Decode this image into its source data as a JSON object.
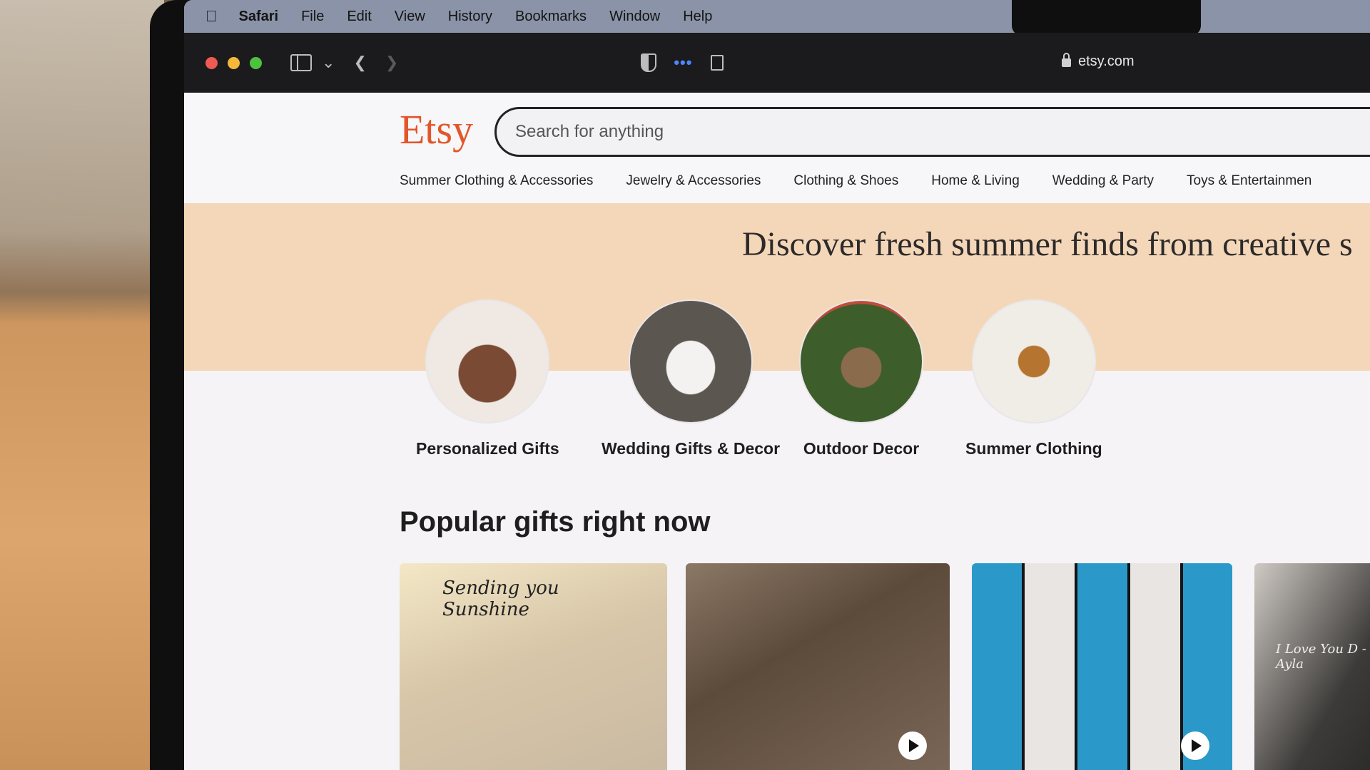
{
  "menubar": {
    "apple_icon": "apple-logo-icon",
    "items": [
      "Safari",
      "File",
      "Edit",
      "View",
      "History",
      "Bookmarks",
      "Window",
      "Help"
    ]
  },
  "toolbar": {
    "address": "etsy.com",
    "icons": [
      "sidebar-icon",
      "chevron-down-icon",
      "back-icon",
      "forward-icon",
      "shield-icon",
      "more-dots-icon",
      "reader-icon",
      "lock-icon"
    ]
  },
  "etsy": {
    "logo": "Etsy",
    "logo_color": "#e2562a",
    "search_placeholder": "Search for anything",
    "nav": [
      "Summer Clothing & Accessories",
      "Jewelry & Accessories",
      "Clothing & Shoes",
      "Home & Living",
      "Wedding & Party",
      "Toys & Entertainmen"
    ],
    "hero_title": "Discover fresh summer finds from creative s",
    "categories": [
      "Personalized Gifts",
      "Wedding Gifts & Decor",
      "Outdoor Decor",
      "Summer Clothing"
    ],
    "section_title": "Popular gifts right now",
    "tiles": {
      "t1_text": "Sending you Sunshine",
      "t4_text": "I Love You D -Ayla"
    }
  },
  "colors": {
    "hero_bg": "#f4d7b9",
    "menubar_bg": "#8b93a8",
    "toolbar_bg": "#1b1b1d"
  }
}
